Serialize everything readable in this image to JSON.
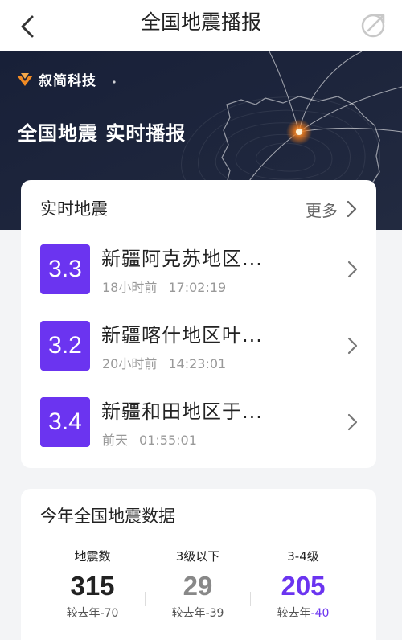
{
  "topbar": {
    "title": "全国地震播报"
  },
  "banner": {
    "brand": "叙简科技",
    "headline": "全国地震 实时播报"
  },
  "realtime": {
    "title": "实时地震",
    "more_label": "更多",
    "items": [
      {
        "magnitude": "3.3",
        "place": "新疆阿克苏地区...",
        "ago": "18小时前",
        "time": "17:02:19"
      },
      {
        "magnitude": "3.2",
        "place": "新疆喀什地区叶...",
        "ago": "20小时前",
        "time": "14:23:01"
      },
      {
        "magnitude": "3.4",
        "place": "新疆和田地区于...",
        "ago": "前天",
        "time": "01:55:01"
      }
    ]
  },
  "yearly": {
    "title": "今年全国地震数据",
    "stats": [
      {
        "label": "地震数",
        "value": "315",
        "cmp_prefix": "较去年",
        "cmp_value": "-70",
        "color": "#222222"
      },
      {
        "label": "3级以下",
        "value": "29",
        "cmp_prefix": "较去年",
        "cmp_value": "-39",
        "color": "#888888"
      },
      {
        "label": "3-4级",
        "value": "205",
        "cmp_prefix": "较去年",
        "cmp_value": "-40",
        "color": "#6b34f0"
      }
    ]
  },
  "colors": {
    "accent": "#6b34f0",
    "banner_bg": "#1b2236",
    "epicenter": "#f07a1a"
  },
  "icons": {
    "back": "chevron-left-icon",
    "share": "share-icon",
    "more": "chevron-right-icon"
  }
}
